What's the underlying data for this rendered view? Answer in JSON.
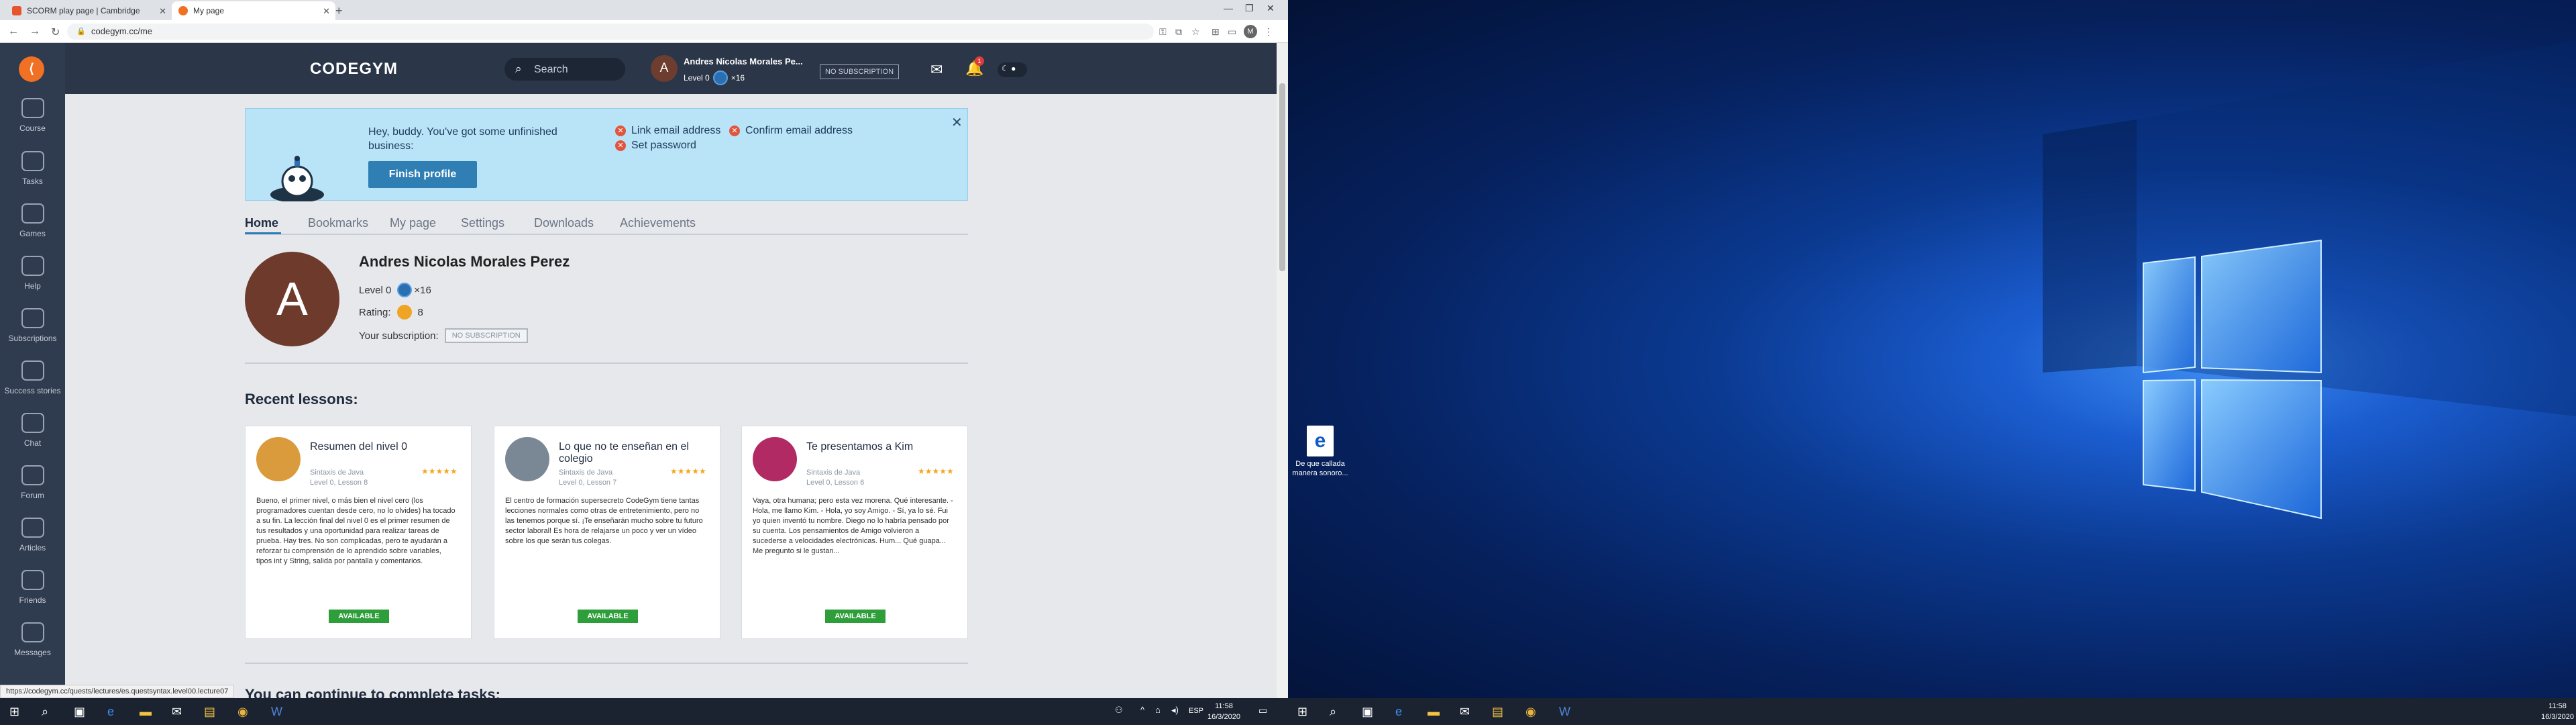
{
  "browser": {
    "tabs": [
      {
        "title": "SCORM play page | Cambridge"
      },
      {
        "title": "My page"
      }
    ],
    "url": "codegym.cc/me",
    "profile_initial": "M",
    "status_url": "https://codegym.cc/quests/lectures/es.questsyntax.level00.lecture07"
  },
  "sidebar": {
    "items": [
      {
        "label": "Course",
        "icon": "course-icon"
      },
      {
        "label": "Tasks",
        "icon": "tasks-icon"
      },
      {
        "label": "Games",
        "icon": "games-icon"
      },
      {
        "label": "Help",
        "icon": "help-icon"
      },
      {
        "label": "Subscriptions",
        "icon": "subscriptions-icon"
      },
      {
        "label": "Success stories",
        "icon": "success-stories-icon"
      },
      {
        "label": "Chat",
        "icon": "chat-icon"
      },
      {
        "label": "Forum",
        "icon": "forum-icon"
      },
      {
        "label": "Articles",
        "icon": "articles-icon"
      },
      {
        "label": "Friends",
        "icon": "friends-icon"
      },
      {
        "label": "Messages",
        "icon": "messages-icon"
      }
    ]
  },
  "header": {
    "brand": "CODEGYM",
    "search_placeholder": "Search",
    "user_initial": "A",
    "user_name": "Andres Nicolas Morales Pe...",
    "level": "Level 0",
    "dark_matter": "×16",
    "subscription": "NO SUBSCRIPTION",
    "notification_count": "1"
  },
  "banner": {
    "message": "Hey, buddy. You've got some unfinished business:",
    "finish_button": "Finish profile",
    "todos": [
      "Link email address",
      "Confirm email address",
      "Set password"
    ]
  },
  "nav_tabs": [
    "Home",
    "Bookmarks",
    "My page",
    "Settings",
    "Downloads",
    "Achievements"
  ],
  "profile": {
    "initial": "A",
    "name": "Andres Nicolas Morales Perez",
    "level": "Level 0",
    "dark_matter": "×16",
    "rating_label": "Rating:",
    "rating_value": "8",
    "subscription_label": "Your subscription:",
    "subscription_value": "NO SUBSCRIPTION"
  },
  "recent": {
    "title": "Recent lessons:",
    "cards": [
      {
        "title": "Resumen del nivel 0",
        "course": "Sintaxis de Java",
        "lesson": "Level 0, Lesson 8",
        "stars": "★★★★★",
        "description": "Bueno, el primer nivel, o más bien el nivel cero (los programadores cuentan desde cero, no lo olvides) ha tocado a su fin. La lección final del nivel 0 es el primer resumen de tus resultados y una oportunidad para realizar tareas de prueba. Hay tres. No son complicadas, pero te ayudarán a reforzar tu comprensión de lo aprendido sobre variables, tipos int y String, salida por pantalla y comentarios.",
        "badge": "AVAILABLE",
        "avatar_color": "#d99b3b"
      },
      {
        "title": "Lo que no te enseñan en el colegio",
        "course": "Sintaxis de Java",
        "lesson": "Level 0, Lesson 7",
        "stars": "★★★★★",
        "description": "El centro de formación supersecreto CodeGym tiene tantas lecciones normales como otras de entretenimiento, pero no las tenemos porque sí. ¡Te enseñarán mucho sobre tu futuro sector laboral! Es hora de relajarse un poco y ver un vídeo sobre los que serán tus colegas.",
        "badge": "AVAILABLE",
        "avatar_color": "#7a8794"
      },
      {
        "title": "Te presentamos a Kim",
        "course": "Sintaxis de Java",
        "lesson": "Level 0, Lesson 6",
        "stars": "★★★★★",
        "description": "Vaya, otra humana; pero esta vez morena. Qué interesante. - Hola, me llamo Kim. - Hola, yo soy Amigo. - Sí, ya lo sé. Fui yo quien inventó tu nombre. Diego no lo habría pensado por su cuenta. Los pensamientos de Amigo volvieron a sucederse a velocidades electrónicas. Hum... Qué guapa... Me pregunto si le gustan...",
        "badge": "AVAILABLE",
        "avatar_color": "#b22a63"
      }
    ]
  },
  "continue_title": "You can continue to complete tasks:",
  "taskbar_left": {
    "lang": "ESP",
    "time": "11:58",
    "date": "16/3/2020"
  },
  "taskbar_right": {
    "time": "11:58",
    "date": "16/3/2020"
  },
  "desktop": {
    "icon_label": "De que callada manera sonoro..."
  }
}
